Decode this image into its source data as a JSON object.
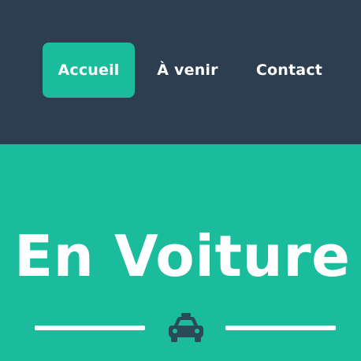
{
  "nav": {
    "items": [
      {
        "label": "Accueil",
        "active": true
      },
      {
        "label": "À venir",
        "active": false
      },
      {
        "label": "Contact",
        "active": false
      }
    ]
  },
  "hero": {
    "title": "En Voiture"
  },
  "icons": {
    "divider_icon": "taxi-icon"
  },
  "colors": {
    "navbar_bg": "#2c3e50",
    "accent": "#1abc9c",
    "text": "#ffffff",
    "icon": "#2c3e50"
  }
}
